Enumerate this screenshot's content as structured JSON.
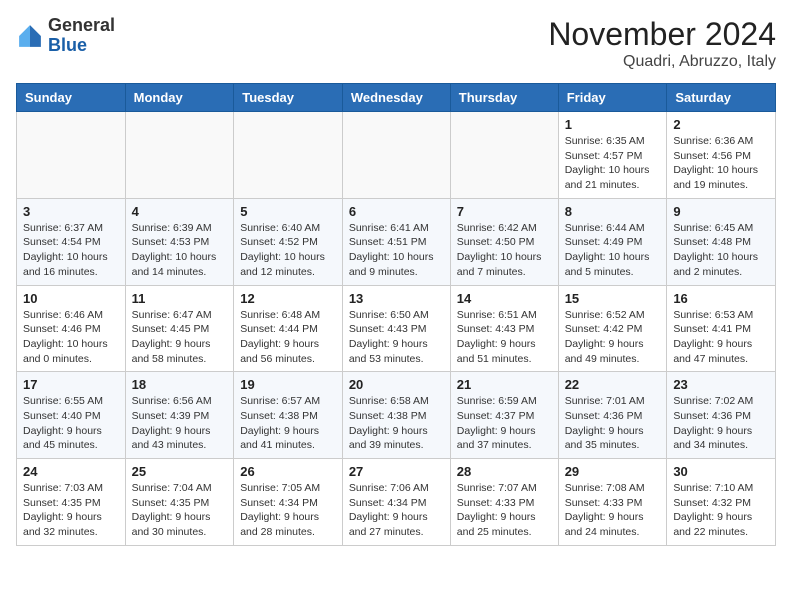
{
  "logo": {
    "line1": "General",
    "line2": "Blue"
  },
  "title": "November 2024",
  "location": "Quadri, Abruzzo, Italy",
  "headers": [
    "Sunday",
    "Monday",
    "Tuesday",
    "Wednesday",
    "Thursday",
    "Friday",
    "Saturday"
  ],
  "weeks": [
    [
      {
        "day": "",
        "info": ""
      },
      {
        "day": "",
        "info": ""
      },
      {
        "day": "",
        "info": ""
      },
      {
        "day": "",
        "info": ""
      },
      {
        "day": "",
        "info": ""
      },
      {
        "day": "1",
        "info": "Sunrise: 6:35 AM\nSunset: 4:57 PM\nDaylight: 10 hours and 21 minutes."
      },
      {
        "day": "2",
        "info": "Sunrise: 6:36 AM\nSunset: 4:56 PM\nDaylight: 10 hours and 19 minutes."
      }
    ],
    [
      {
        "day": "3",
        "info": "Sunrise: 6:37 AM\nSunset: 4:54 PM\nDaylight: 10 hours and 16 minutes."
      },
      {
        "day": "4",
        "info": "Sunrise: 6:39 AM\nSunset: 4:53 PM\nDaylight: 10 hours and 14 minutes."
      },
      {
        "day": "5",
        "info": "Sunrise: 6:40 AM\nSunset: 4:52 PM\nDaylight: 10 hours and 12 minutes."
      },
      {
        "day": "6",
        "info": "Sunrise: 6:41 AM\nSunset: 4:51 PM\nDaylight: 10 hours and 9 minutes."
      },
      {
        "day": "7",
        "info": "Sunrise: 6:42 AM\nSunset: 4:50 PM\nDaylight: 10 hours and 7 minutes."
      },
      {
        "day": "8",
        "info": "Sunrise: 6:44 AM\nSunset: 4:49 PM\nDaylight: 10 hours and 5 minutes."
      },
      {
        "day": "9",
        "info": "Sunrise: 6:45 AM\nSunset: 4:48 PM\nDaylight: 10 hours and 2 minutes."
      }
    ],
    [
      {
        "day": "10",
        "info": "Sunrise: 6:46 AM\nSunset: 4:46 PM\nDaylight: 10 hours and 0 minutes."
      },
      {
        "day": "11",
        "info": "Sunrise: 6:47 AM\nSunset: 4:45 PM\nDaylight: 9 hours and 58 minutes."
      },
      {
        "day": "12",
        "info": "Sunrise: 6:48 AM\nSunset: 4:44 PM\nDaylight: 9 hours and 56 minutes."
      },
      {
        "day": "13",
        "info": "Sunrise: 6:50 AM\nSunset: 4:43 PM\nDaylight: 9 hours and 53 minutes."
      },
      {
        "day": "14",
        "info": "Sunrise: 6:51 AM\nSunset: 4:43 PM\nDaylight: 9 hours and 51 minutes."
      },
      {
        "day": "15",
        "info": "Sunrise: 6:52 AM\nSunset: 4:42 PM\nDaylight: 9 hours and 49 minutes."
      },
      {
        "day": "16",
        "info": "Sunrise: 6:53 AM\nSunset: 4:41 PM\nDaylight: 9 hours and 47 minutes."
      }
    ],
    [
      {
        "day": "17",
        "info": "Sunrise: 6:55 AM\nSunset: 4:40 PM\nDaylight: 9 hours and 45 minutes."
      },
      {
        "day": "18",
        "info": "Sunrise: 6:56 AM\nSunset: 4:39 PM\nDaylight: 9 hours and 43 minutes."
      },
      {
        "day": "19",
        "info": "Sunrise: 6:57 AM\nSunset: 4:38 PM\nDaylight: 9 hours and 41 minutes."
      },
      {
        "day": "20",
        "info": "Sunrise: 6:58 AM\nSunset: 4:38 PM\nDaylight: 9 hours and 39 minutes."
      },
      {
        "day": "21",
        "info": "Sunrise: 6:59 AM\nSunset: 4:37 PM\nDaylight: 9 hours and 37 minutes."
      },
      {
        "day": "22",
        "info": "Sunrise: 7:01 AM\nSunset: 4:36 PM\nDaylight: 9 hours and 35 minutes."
      },
      {
        "day": "23",
        "info": "Sunrise: 7:02 AM\nSunset: 4:36 PM\nDaylight: 9 hours and 34 minutes."
      }
    ],
    [
      {
        "day": "24",
        "info": "Sunrise: 7:03 AM\nSunset: 4:35 PM\nDaylight: 9 hours and 32 minutes."
      },
      {
        "day": "25",
        "info": "Sunrise: 7:04 AM\nSunset: 4:35 PM\nDaylight: 9 hours and 30 minutes."
      },
      {
        "day": "26",
        "info": "Sunrise: 7:05 AM\nSunset: 4:34 PM\nDaylight: 9 hours and 28 minutes."
      },
      {
        "day": "27",
        "info": "Sunrise: 7:06 AM\nSunset: 4:34 PM\nDaylight: 9 hours and 27 minutes."
      },
      {
        "day": "28",
        "info": "Sunrise: 7:07 AM\nSunset: 4:33 PM\nDaylight: 9 hours and 25 minutes."
      },
      {
        "day": "29",
        "info": "Sunrise: 7:08 AM\nSunset: 4:33 PM\nDaylight: 9 hours and 24 minutes."
      },
      {
        "day": "30",
        "info": "Sunrise: 7:10 AM\nSunset: 4:32 PM\nDaylight: 9 hours and 22 minutes."
      }
    ]
  ]
}
